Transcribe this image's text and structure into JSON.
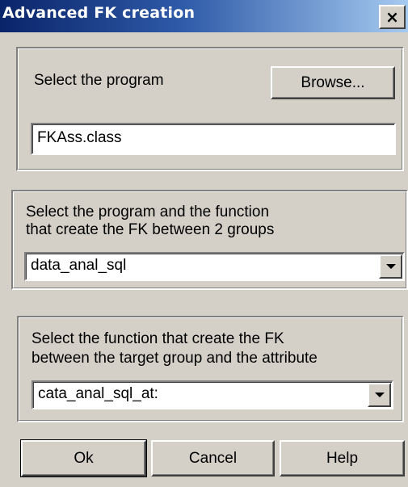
{
  "window": {
    "title": "Advanced FK creation",
    "close_glyph": "×"
  },
  "program": {
    "label": "Select the program",
    "browse_label": "Browse...",
    "value": "FKAss.class"
  },
  "group_function": {
    "label_line1": "Select the program and the function",
    "label_line2": "that create the FK between 2 groups",
    "selected": "data_anal_sql"
  },
  "attr_function": {
    "label_line1": "Select the function that create the FK",
    "label_line2": "between the target group and the attribute",
    "selected": "cata_anal_sql_at:"
  },
  "buttons": {
    "ok": "Ok",
    "cancel": "Cancel",
    "help": "Help"
  }
}
